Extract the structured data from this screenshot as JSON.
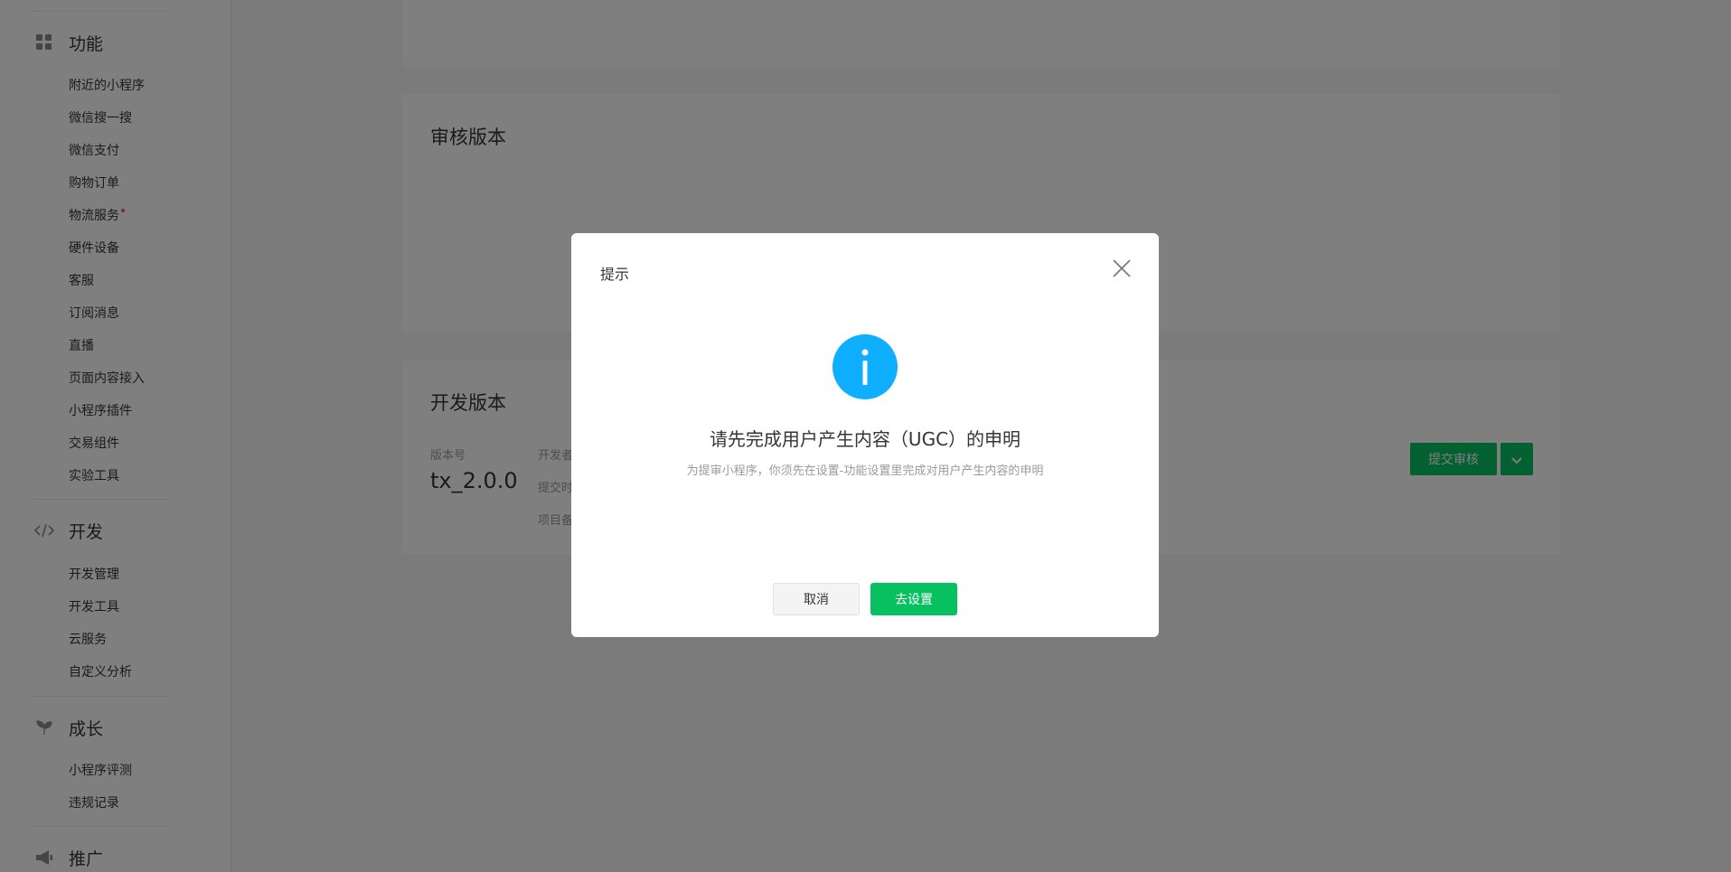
{
  "sidebar": {
    "sections": [
      {
        "title": "功能",
        "icon": "grid-icon",
        "items": [
          "附近的小程序",
          "微信搜一搜",
          "微信支付",
          "购物订单",
          "物流服务",
          "硬件设备",
          "客服",
          "订阅消息",
          "直播",
          "页面内容接入",
          "小程序插件",
          "交易组件",
          "实验工具"
        ]
      },
      {
        "title": "开发",
        "icon": "code-icon",
        "items": [
          "开发管理",
          "开发工具",
          "云服务",
          "自定义分析"
        ]
      },
      {
        "title": "成长",
        "icon": "sprout-icon",
        "items": [
          "小程序评测",
          "违规记录"
        ]
      },
      {
        "title": "推广",
        "icon": "megaphone-icon",
        "items": []
      }
    ]
  },
  "main": {
    "review_card": {
      "title": "审核版本"
    },
    "dev_card": {
      "title": "开发版本",
      "version_label": "版本号",
      "version_value": "tx_2.0.0",
      "developer_label": "开发者",
      "submit_time_label": "提交时",
      "remark_label": "项目备",
      "submit_button": "提交审核"
    }
  },
  "dialog": {
    "title": "提示",
    "heading": "请先完成用户产生内容（UGC）的申明",
    "description": "为提审小程序，你须先在设置-功能设置里完成对用户产生内容的申明",
    "cancel": "取消",
    "confirm": "去设置"
  },
  "colors": {
    "brand_green": "#07c160",
    "info_blue": "#10aeff",
    "badge_red": "#fa5151"
  }
}
